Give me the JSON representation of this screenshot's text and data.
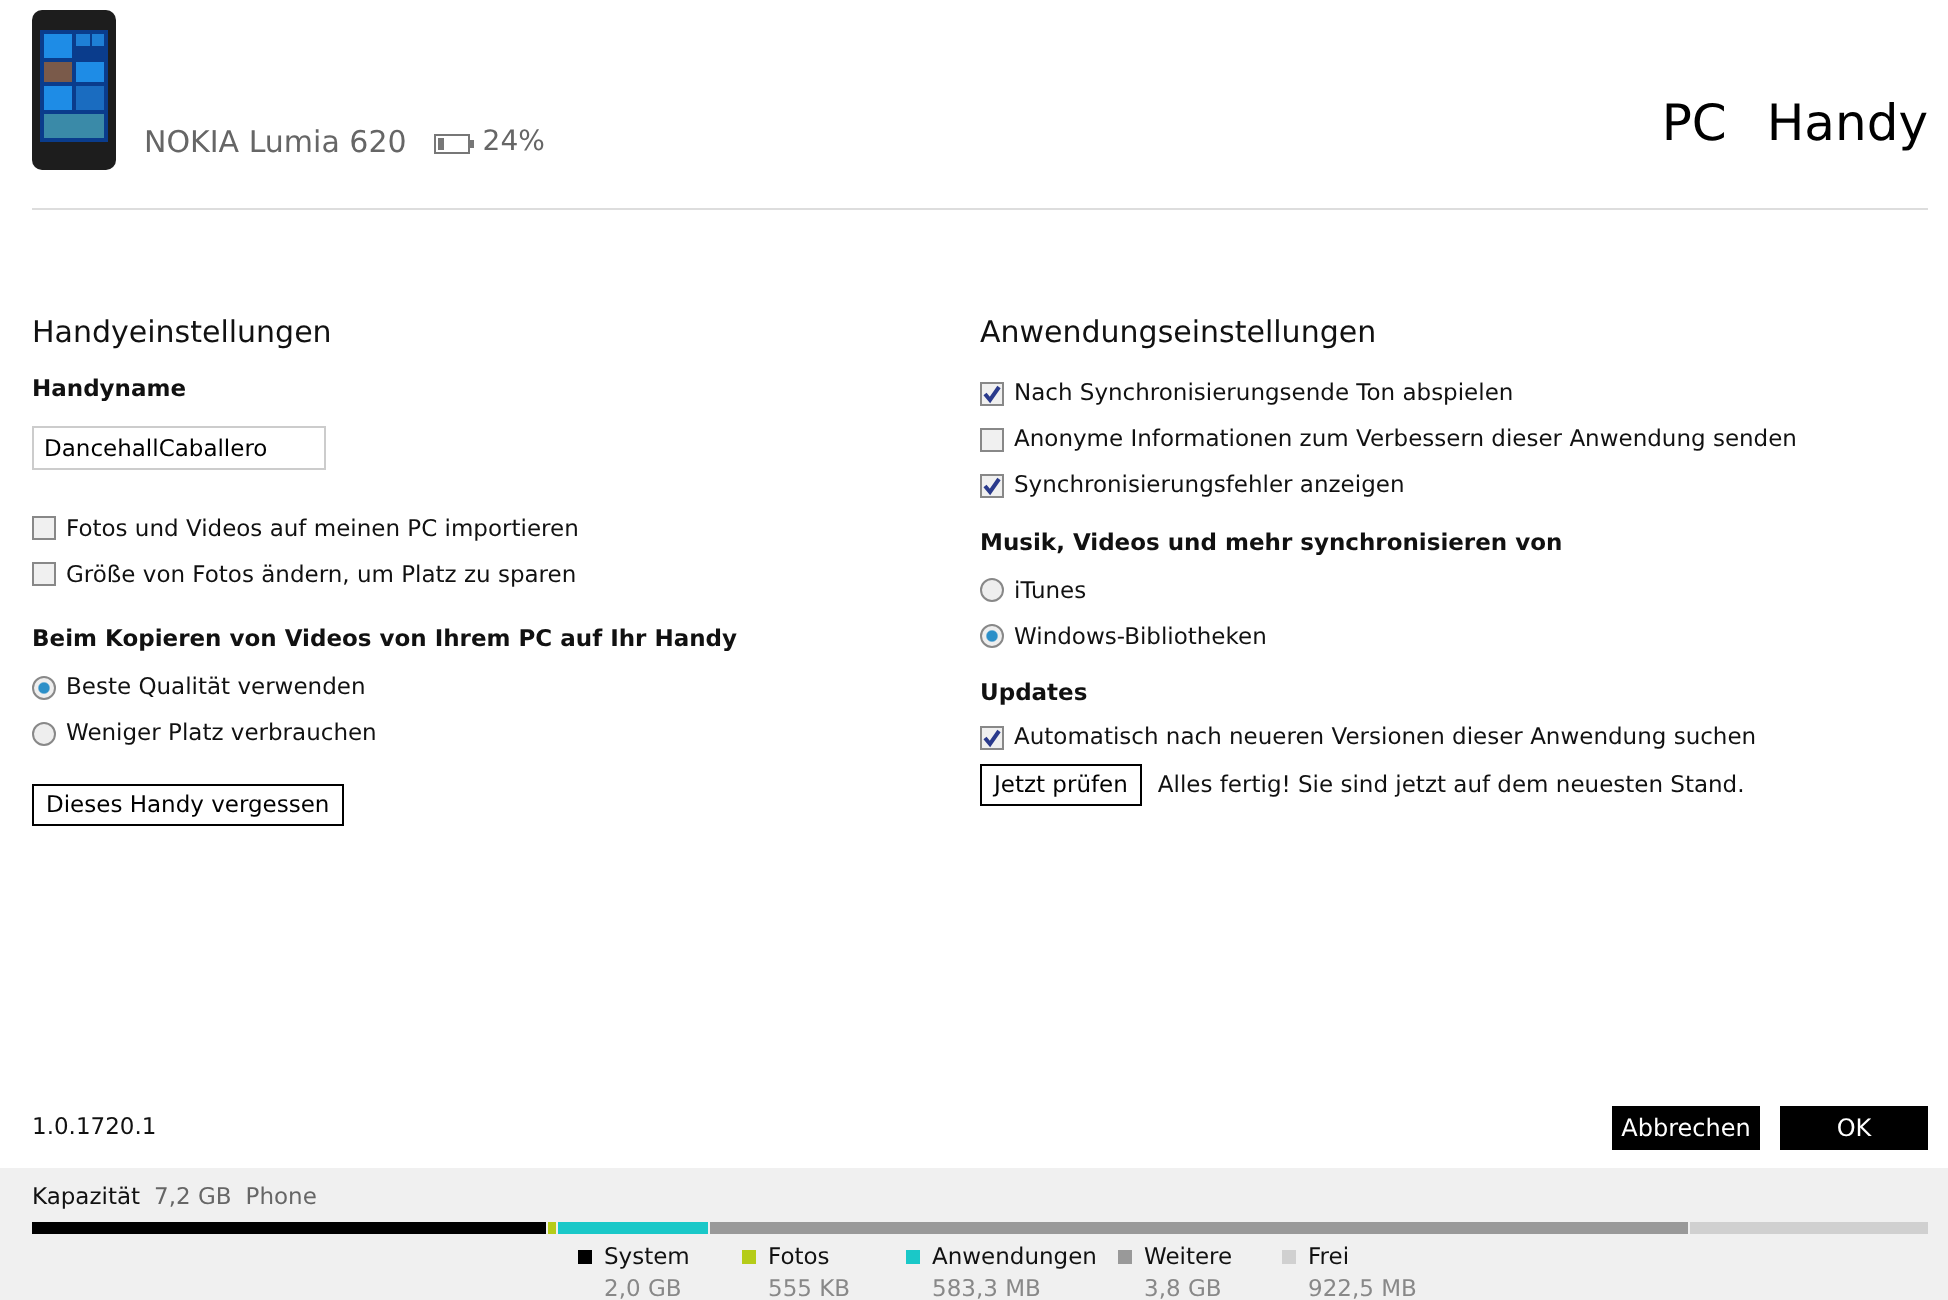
{
  "device": {
    "name": "NOKIA Lumia 620",
    "battery": "24%"
  },
  "nav": [
    "PC",
    "Handy"
  ],
  "phone_settings": {
    "title": "Handyeinstellungen",
    "name_label": "Handyname",
    "name_value": "DancehallCaballero",
    "checkboxes": [
      {
        "label": "Fotos und Videos auf meinen PC importieren",
        "checked": false
      },
      {
        "label": "Größe von Fotos ändern, um Platz zu sparen",
        "checked": false
      }
    ],
    "copy_label": "Beim Kopieren von Videos von Ihrem PC auf Ihr Handy",
    "radios": [
      {
        "label": "Beste Qualität verwenden",
        "selected": true
      },
      {
        "label": "Weniger Platz verbrauchen",
        "selected": false
      }
    ],
    "forget_button": "Dieses Handy vergessen"
  },
  "app_settings": {
    "title": "Anwendungseinstellungen",
    "checkboxes": [
      {
        "label": "Nach Synchronisierungsende Ton abspielen",
        "checked": true
      },
      {
        "label": "Anonyme Informationen zum Verbessern dieser Anwendung senden",
        "checked": false
      },
      {
        "label": "Synchronisierungsfehler anzeigen",
        "checked": true
      }
    ],
    "sync_label": "Musik, Videos und mehr synchronisieren von",
    "radios": [
      {
        "label": "iTunes",
        "selected": false
      },
      {
        "label": "Windows-Bibliotheken",
        "selected": true
      }
    ],
    "updates_label": "Updates",
    "update_checkbox": {
      "label": "Automatisch nach neueren Versionen dieser Anwendung suchen",
      "checked": true
    },
    "check_button": "Jetzt prüfen",
    "status": "Alles fertig! Sie sind jetzt auf dem neuesten Stand."
  },
  "version": "1.0.1720.1",
  "buttons": [
    "Abbrechen",
    "OK"
  ],
  "capacity": {
    "label": "Kapazität",
    "total": "7,2 GB",
    "storage": "Phone",
    "segments": [
      {
        "name": "System",
        "size": "2,0 GB",
        "color": "#000000"
      },
      {
        "name": "Fotos",
        "size": "555 KB",
        "color": "#b5cc18"
      },
      {
        "name": "Anwendungen",
        "size": "583,3 MB",
        "color": "#1ac8c8"
      },
      {
        "name": "Weitere",
        "size": "3,8 GB",
        "color": "#999999"
      },
      {
        "name": "Frei",
        "size": "922,5 MB",
        "color": "#d0d0d0"
      }
    ]
  }
}
